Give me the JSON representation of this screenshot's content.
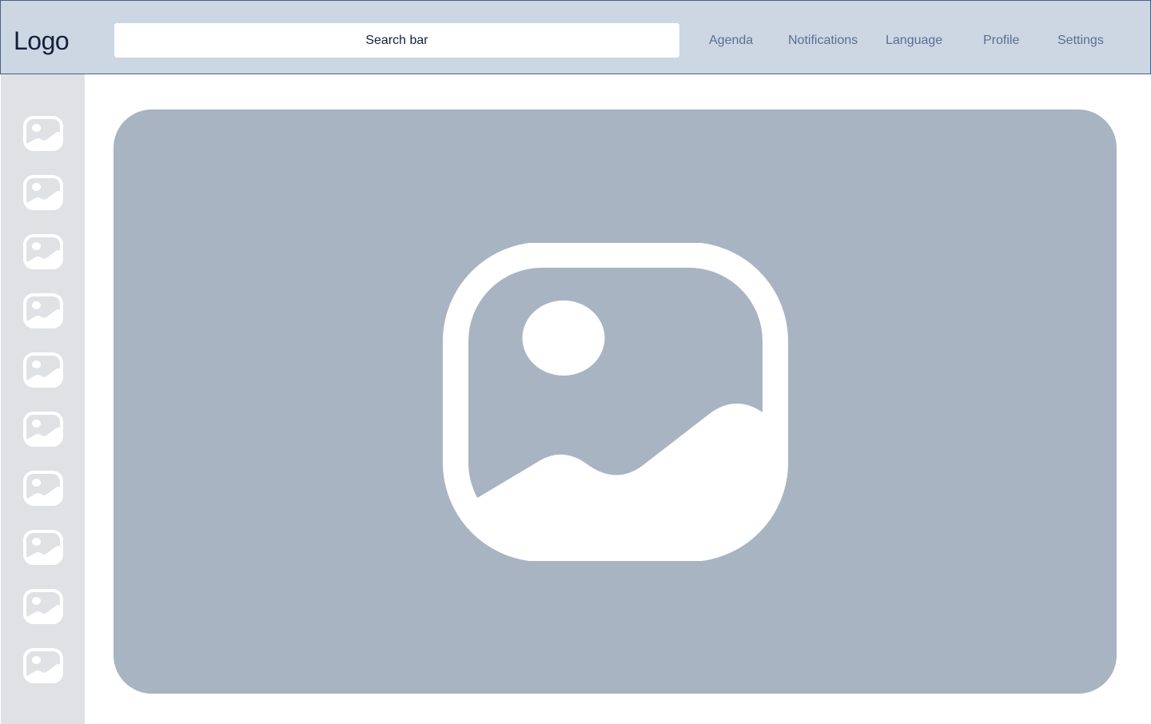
{
  "header": {
    "logo": "Logo",
    "search": {
      "placeholder": "Search bar"
    },
    "nav": [
      {
        "label": "Agenda"
      },
      {
        "label": "Notifications"
      },
      {
        "label": "Language"
      },
      {
        "label": "Profile"
      },
      {
        "label": "Settings"
      }
    ]
  },
  "sidebar": {
    "thumbnails": [
      {
        "icon": "image-icon"
      },
      {
        "icon": "image-icon"
      },
      {
        "icon": "image-icon"
      },
      {
        "icon": "image-icon"
      },
      {
        "icon": "image-icon"
      },
      {
        "icon": "image-icon"
      },
      {
        "icon": "image-icon"
      },
      {
        "icon": "image-icon"
      },
      {
        "icon": "image-icon"
      },
      {
        "icon": "image-icon"
      }
    ]
  },
  "main": {
    "preview": {
      "icon": "image-icon"
    }
  },
  "colors": {
    "header_bg": "#cdd7e3",
    "header_border": "#4a5f80",
    "sidebar_bg": "#dfe1e5",
    "image_placeholder_bg": "#a9b4c2",
    "nav_text": "#5a6f93",
    "logo_text": "#15213a"
  }
}
